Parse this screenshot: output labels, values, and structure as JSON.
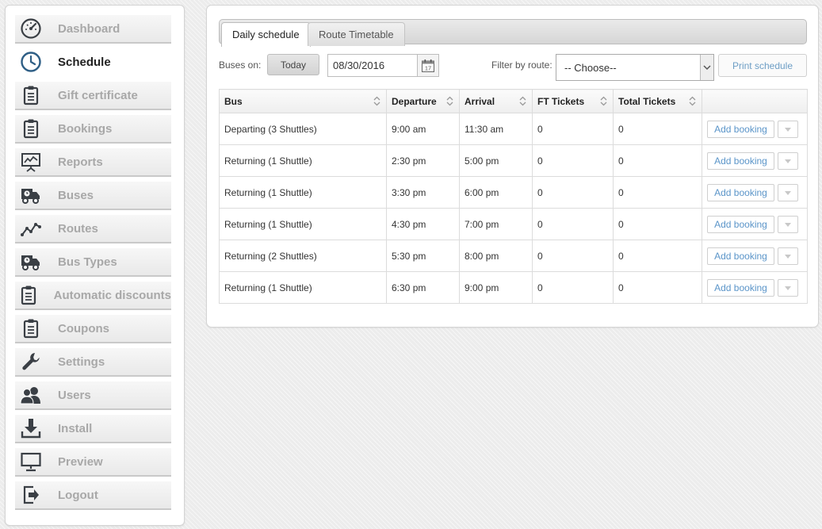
{
  "sidebar": {
    "items": [
      {
        "id": "dashboard",
        "label": "Dashboard",
        "icon": "dashboard-gauge-icon",
        "active": false
      },
      {
        "id": "schedule",
        "label": "Schedule",
        "icon": "clock-icon",
        "active": true
      },
      {
        "id": "gift-certificate",
        "label": "Gift certificate",
        "icon": "clipboard-icon",
        "active": false
      },
      {
        "id": "bookings",
        "label": "Bookings",
        "icon": "clipboard-icon",
        "active": false
      },
      {
        "id": "reports",
        "label": "Reports",
        "icon": "presentation-chart-icon",
        "active": false
      },
      {
        "id": "buses",
        "label": "Buses",
        "icon": "truck-clock-icon",
        "active": false
      },
      {
        "id": "routes",
        "label": "Routes",
        "icon": "line-graph-icon",
        "active": false
      },
      {
        "id": "bus-types",
        "label": "Bus Types",
        "icon": "truck-clock-icon",
        "active": false
      },
      {
        "id": "automatic-discounts",
        "label": "Automatic discounts",
        "icon": "clipboard-icon",
        "active": false
      },
      {
        "id": "coupons",
        "label": "Coupons",
        "icon": "clipboard-icon",
        "active": false
      },
      {
        "id": "settings",
        "label": "Settings",
        "icon": "wrench-icon",
        "active": false
      },
      {
        "id": "users",
        "label": "Users",
        "icon": "users-icon",
        "active": false
      },
      {
        "id": "install",
        "label": "Install",
        "icon": "download-icon",
        "active": false
      },
      {
        "id": "preview",
        "label": "Preview",
        "icon": "monitor-icon",
        "active": false
      },
      {
        "id": "logout",
        "label": "Logout",
        "icon": "logout-icon",
        "active": false
      }
    ]
  },
  "tabs": [
    {
      "label": "Daily schedule",
      "active": true
    },
    {
      "label": "Route Timetable",
      "active": false
    }
  ],
  "toolbar": {
    "buses_on_label": "Buses on:",
    "today_label": "Today",
    "date_value": "08/30/2016",
    "calendar_day": "17",
    "filter_label": "Filter by route:",
    "route_select_value": "-- Choose--",
    "print_label": "Print schedule"
  },
  "table": {
    "columns": [
      "Bus",
      "Departure",
      "Arrival",
      "FT Tickets",
      "Total Tickets",
      ""
    ],
    "rows": [
      {
        "bus": "Departing (3 Shuttles)",
        "departure": "9:00 am",
        "arrival": "11:30 am",
        "ft_tickets": "0",
        "total_tickets": "0"
      },
      {
        "bus": "Returning (1 Shuttle)",
        "departure": "2:30 pm",
        "arrival": "5:00 pm",
        "ft_tickets": "0",
        "total_tickets": "0"
      },
      {
        "bus": "Returning (1 Shuttle)",
        "departure": "3:30 pm",
        "arrival": "6:00 pm",
        "ft_tickets": "0",
        "total_tickets": "0"
      },
      {
        "bus": "Returning (1 Shuttle)",
        "departure": "4:30 pm",
        "arrival": "7:00 pm",
        "ft_tickets": "0",
        "total_tickets": "0"
      },
      {
        "bus": "Returning (2 Shuttles)",
        "departure": "5:30 pm",
        "arrival": "8:00 pm",
        "ft_tickets": "0",
        "total_tickets": "0"
      },
      {
        "bus": "Returning (1 Shuttle)",
        "departure": "6:30 pm",
        "arrival": "9:00 pm",
        "ft_tickets": "0",
        "total_tickets": "0"
      }
    ],
    "add_booking_label": "Add booking"
  },
  "colors": {
    "accent_link": "#5b95c9",
    "active_nav_text": "#222222",
    "inactive_nav_text": "#a8a8a8",
    "icon_dark": "#3a3f45"
  }
}
